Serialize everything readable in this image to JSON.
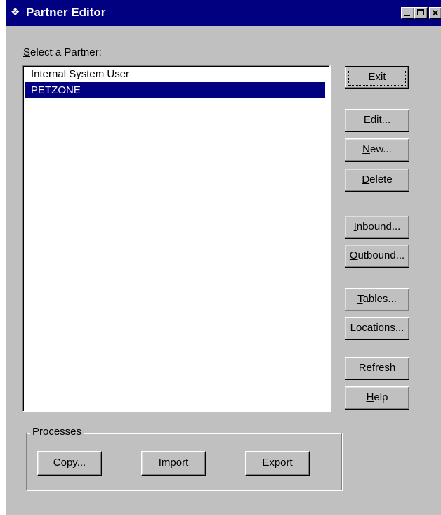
{
  "window": {
    "title": "Partner Editor",
    "icon": "partner-editor-app-icon",
    "controls": {
      "minimize": "minimize-icon",
      "maximize": "maximize-icon",
      "close": "close-icon"
    }
  },
  "list": {
    "label_accel": "S",
    "label_rest": "elect a Partner:",
    "items": [
      {
        "label": "Internal System User",
        "selected": false
      },
      {
        "label": "PETZONE",
        "selected": true
      }
    ]
  },
  "buttons": {
    "exit": {
      "pre": "",
      "accel": "",
      "post": "Exit"
    },
    "edit": {
      "pre": "",
      "accel": "E",
      "post": "dit..."
    },
    "new": {
      "pre": "",
      "accel": "N",
      "post": "ew..."
    },
    "delete": {
      "pre": "",
      "accel": "D",
      "post": "elete"
    },
    "inbound": {
      "pre": "",
      "accel": "I",
      "post": "nbound..."
    },
    "outbound": {
      "pre": "",
      "accel": "O",
      "post": "utbound..."
    },
    "tables": {
      "pre": "",
      "accel": "T",
      "post": "ables..."
    },
    "locations": {
      "pre": "",
      "accel": "L",
      "post": "ocations..."
    },
    "refresh": {
      "pre": "",
      "accel": "R",
      "post": "efresh"
    },
    "help": {
      "pre": "",
      "accel": "H",
      "post": "elp"
    }
  },
  "processes": {
    "label": "Processes",
    "copy": {
      "pre": "",
      "accel": "C",
      "post": "opy..."
    },
    "import": {
      "pre": "I",
      "accel": "m",
      "post": "port"
    },
    "export": {
      "pre": "E",
      "accel": "x",
      "post": "port"
    }
  },
  "colors": {
    "titlebar": "#000080",
    "face": "#c0c0c0",
    "selection": "#000080"
  }
}
